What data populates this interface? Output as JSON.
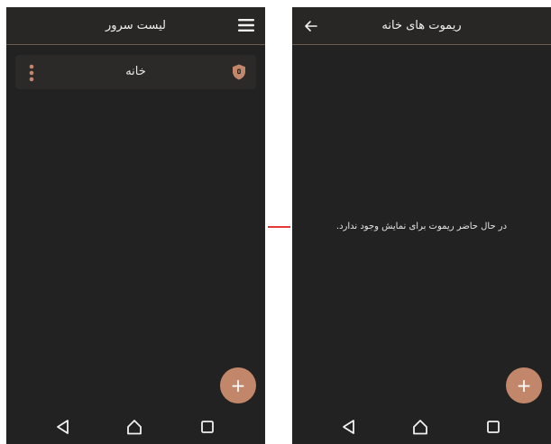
{
  "left_screen": {
    "title": "لیست سرور",
    "servers": [
      {
        "name": "خانه"
      }
    ],
    "fab_label": "+",
    "icons": {
      "menu": "hamburger-menu-icon",
      "item_options": "kebab-vertical-icon",
      "item_status": "shield-icon"
    }
  },
  "right_screen": {
    "title": "ریموت های خانه",
    "empty_message": "در حال حاضر ریموت برای نمایش وجود ندارد.",
    "fab_label": "+",
    "icons": {
      "back": "arrow-back-icon"
    }
  },
  "navbar": {
    "icons": [
      "triangle-back-icon",
      "home-outline-icon",
      "square-recents-icon"
    ]
  },
  "colors": {
    "background": "#232222",
    "appbar": "#292726",
    "accent": "#c2876a",
    "text": "#f1f1f1",
    "connector": "#e53935"
  }
}
